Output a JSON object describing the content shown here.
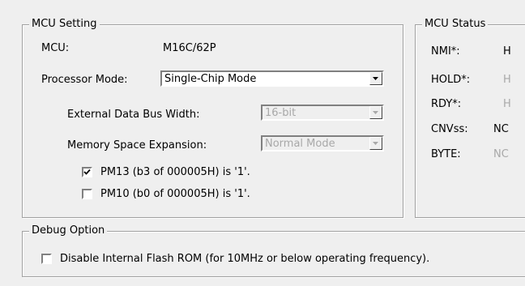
{
  "mcu_setting": {
    "title": "MCU Setting",
    "mcu_label": "MCU:",
    "mcu_value": "M16C/62P",
    "processor_mode_label": "Processor Mode:",
    "processor_mode_value": "Single-Chip Mode",
    "external_bus_label": "External Data Bus Width:",
    "external_bus_value": "16-bit",
    "memory_space_label": "Memory Space Expansion:",
    "memory_space_value": "Normal Mode",
    "pm13_label": "PM13 (b3 of 000005H) is '1'.",
    "pm13_checked": true,
    "pm10_label": "PM10 (b0 of 000005H) is '1'.",
    "pm10_checked": false
  },
  "mcu_status": {
    "title": "MCU Status",
    "rows": [
      {
        "label": "NMI*:",
        "value": "H",
        "enabled": true
      },
      {
        "label": "HOLD*:",
        "value": "H",
        "enabled": false
      },
      {
        "label": "RDY*:",
        "value": "H",
        "enabled": false
      },
      {
        "label": "CNVss:",
        "value": "NC",
        "enabled": true
      },
      {
        "label": "BYTE:",
        "value": "NC",
        "enabled": false
      }
    ]
  },
  "debug_option": {
    "title": "Debug Option",
    "disable_flash_label": "Disable Internal Flash ROM (for 10MHz or below operating frequency).",
    "disable_flash_checked": false
  },
  "icons": {
    "dropdown": "chevron-down-icon",
    "checkmark": "checkmark-icon"
  }
}
